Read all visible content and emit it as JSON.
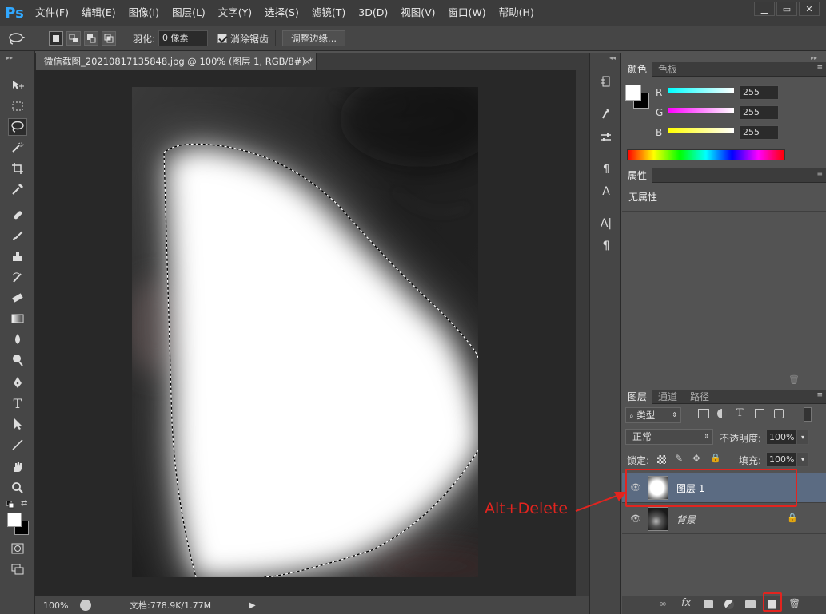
{
  "app": {
    "logo": "Ps"
  },
  "menu": [
    "文件(F)",
    "编辑(E)",
    "图像(I)",
    "图层(L)",
    "文字(Y)",
    "选择(S)",
    "滤镜(T)",
    "3D(D)",
    "视图(V)",
    "窗口(W)",
    "帮助(H)"
  ],
  "window_controls": {
    "minimize": "▁",
    "restore": "▭",
    "close": "✕"
  },
  "options": {
    "feather_label": "羽化:",
    "feather_value": "0 像素",
    "antialias_label": "消除锯齿",
    "antialias_checked": true,
    "refine_edge_button": "调整边缘..."
  },
  "document": {
    "tab_title": "微信截图_20210817135848.jpg @ 100% (图层 1, RGB/8#) *",
    "tab_close": "×",
    "zoom": "100%",
    "doc_info": "文档:778.9K/1.77M"
  },
  "color_panel": {
    "tabs": [
      "颜色",
      "色板"
    ],
    "channels": [
      {
        "label": "R",
        "value": "255",
        "gradient": "#00ffff"
      },
      {
        "label": "G",
        "value": "255",
        "gradient": "#ff00ff"
      },
      {
        "label": "B",
        "value": "255",
        "gradient": "#ffff00"
      }
    ]
  },
  "properties_panel": {
    "tab": "属性",
    "content": "无属性"
  },
  "layers_panel": {
    "tabs": [
      "图层",
      "通道",
      "路径"
    ],
    "filter_kind": "类型",
    "blend_mode": "正常",
    "opacity_label": "不透明度:",
    "opacity_value": "100%",
    "lock_label": "锁定:",
    "fill_label": "填充:",
    "fill_value": "100%",
    "layers": [
      {
        "name": "图层 1",
        "selected": true
      },
      {
        "name": "背景",
        "locked": true
      }
    ]
  },
  "annotation": {
    "text": "Alt+Delete",
    "color": "#e2241f"
  }
}
